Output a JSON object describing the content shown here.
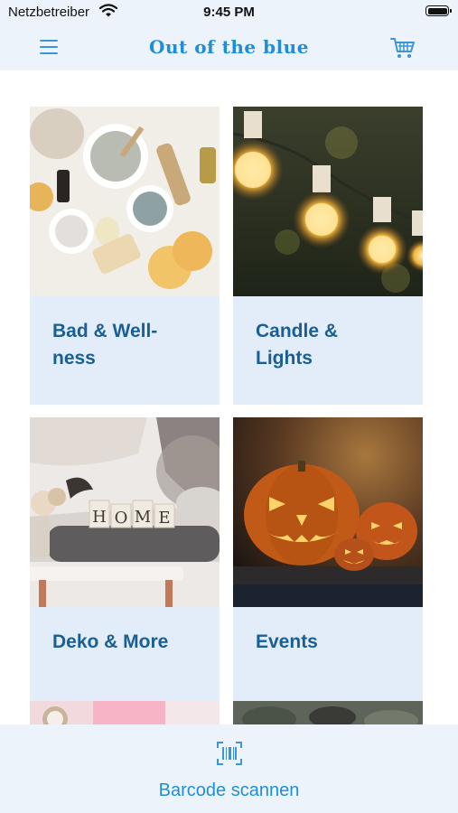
{
  "status_bar": {
    "carrier": "Netzbetreiber",
    "time": "9:45 PM"
  },
  "header": {
    "logo_text": "Out of the blue",
    "menu_icon": "hamburger-menu-icon",
    "cart_icon": "shopping-cart-icon"
  },
  "categories": [
    {
      "label": "Bad & Well-\nness"
    },
    {
      "label": "Candle &\nLights"
    },
    {
      "label": "Deko & More"
    },
    {
      "label": "Events"
    }
  ],
  "bottom_bar": {
    "label": "Barcode scannen",
    "icon": "barcode-scanner-icon"
  },
  "colors": {
    "accent": "#1e8fd6",
    "label_text": "#1a5f93",
    "tile_bg": "#e3edf9",
    "bar_bg": "#edf3fb"
  }
}
